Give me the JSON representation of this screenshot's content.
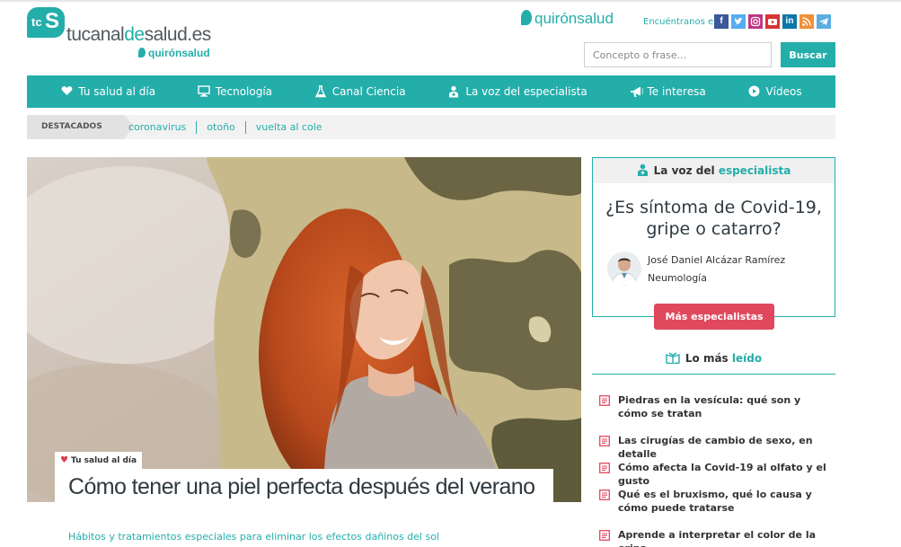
{
  "logo": {
    "badge_left": "tc",
    "badge_right": "S",
    "text_a": "tucanal",
    "text_b": "de",
    "text_c": "salud.es",
    "sub": "quirónsalud"
  },
  "header": {
    "brand": "quirónsalud",
    "follow_label": "Encuéntranos en:",
    "social": [
      "facebook-icon",
      "twitter-icon",
      "instagram-icon",
      "youtube-icon",
      "linkedin-icon",
      "rss-icon",
      "telegram-icon"
    ],
    "social_colors": [
      "#3b5998",
      "#55acee",
      "#c13584",
      "#d93333",
      "#0e76a8",
      "#f18f38",
      "#5aaee0"
    ]
  },
  "search": {
    "placeholder": "Concepto o frase...",
    "value": "",
    "button": "Buscar"
  },
  "nav": {
    "items": [
      {
        "label": "Tu salud al día",
        "icon": "heart-icon"
      },
      {
        "label": "Tecnología",
        "icon": "monitor-icon"
      },
      {
        "label": "Canal Ciencia",
        "icon": "flask-icon"
      },
      {
        "label": "La voz del especialista",
        "icon": "doctor-icon"
      },
      {
        "label": "Te interesa",
        "icon": "megaphone-icon"
      },
      {
        "label": "Vídeos",
        "icon": "play-icon"
      }
    ]
  },
  "destacados": {
    "label": "DESTACADOS",
    "links": [
      "coronavirus",
      "otoño",
      "vuelta al cole"
    ]
  },
  "hero": {
    "category": "Tu salud al día",
    "title": "Cómo tener una piel perfecta después del verano",
    "subtitle": "Hábitos y tratamientos especiales para eliminar los efectos dañinos del sol"
  },
  "especialista": {
    "title_a": "La voz del ",
    "title_b": "especialista",
    "question": "¿Es síntoma de Covid-19, gripe o catarro?",
    "doctor_name": "José Daniel Alcázar Ramírez",
    "doctor_area": "Neumología",
    "button": "Más especialistas"
  },
  "mas_leido": {
    "title_a": "Lo más ",
    "title_b": "leído",
    "items": [
      "Piedras en la vesícula: qué son y cómo se tratan",
      "Las cirugías de cambio de sexo, en detalle",
      "Cómo afecta la Covid-19 al olfato y el gusto",
      "Qué es el bruxismo, qué lo causa y cómo puede tratarse",
      "Aprende a interpretar el color de la orina"
    ]
  },
  "colors": {
    "accent": "#23aeaa",
    "button_red": "#e0485e"
  }
}
